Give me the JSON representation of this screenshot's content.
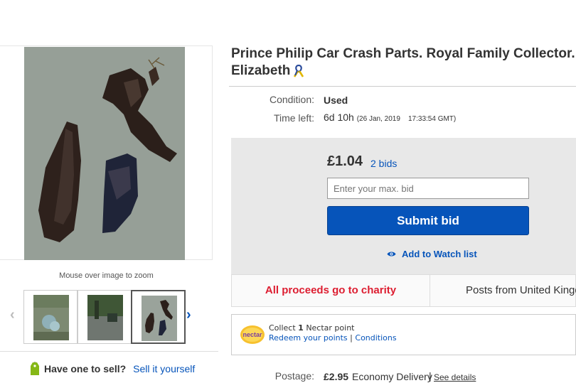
{
  "gallery": {
    "zoom_hint": "Mouse over image to zoom",
    "thumbnail_count": 3,
    "selected_thumbnail": 3
  },
  "sell": {
    "question": "Have one to sell?",
    "link": "Sell it yourself"
  },
  "listing": {
    "title_line1": "Prince Philip Car Crash Parts. Royal Family Collector. Qu",
    "title_line2": "Elizabeth",
    "condition_label": "Condition:",
    "condition_value": "Used",
    "time_left_label": "Time left:",
    "time_left_value": "6d 10h",
    "time_left_end": "(26 Jan, 2019    17:33:54 GMT)"
  },
  "bid": {
    "price": "£1.04",
    "bids": "2 bids",
    "input_placeholder": "Enter your max. bid",
    "submit_label": "Submit bid",
    "watch_label": "Add to Watch list"
  },
  "info": {
    "charity": "All proceeds go to charity",
    "posts_from": "Posts from United Kingdo"
  },
  "nectar": {
    "logo_text": "nectar",
    "collect_prefix": "Collect",
    "points": "1",
    "collect_suffix": "Nectar point",
    "redeem_link": "Redeem your points",
    "separator": "|",
    "conditions_link": "Conditions"
  },
  "postage": {
    "label": "Postage:",
    "price": "£2.95",
    "method": "Economy Delivery",
    "separator": "|",
    "details_link": "See details"
  },
  "colors": {
    "link_blue": "#0654ba",
    "charity_red": "#dd1e31",
    "bid_panel": "#e8e8e8"
  }
}
